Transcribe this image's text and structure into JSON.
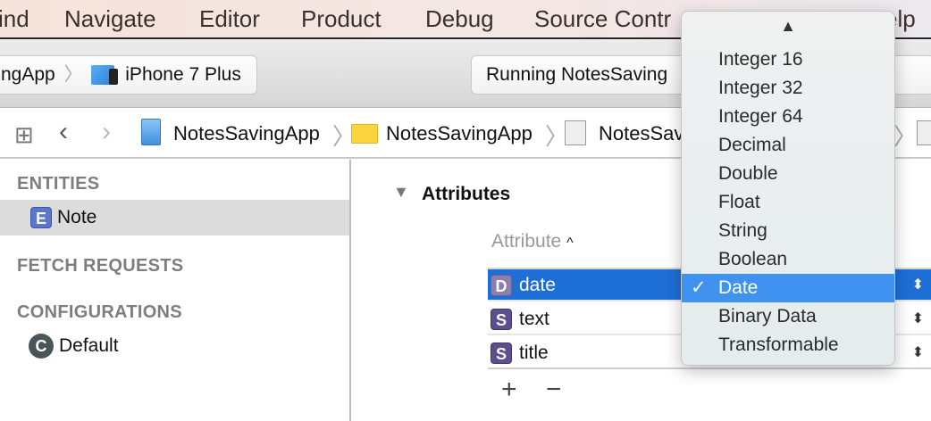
{
  "menubar": {
    "items": [
      "ind",
      "Navigate",
      "Editor",
      "Product",
      "Debug",
      "Source Contr",
      "elp"
    ]
  },
  "toolbar": {
    "scheme": "ngApp",
    "device": "iPhone 7 Plus",
    "status": "Running NotesSaving"
  },
  "breadcrumb": {
    "items": [
      "NotesSavingApp",
      "NotesSavingApp",
      "NotesSav"
    ]
  },
  "sidebar": {
    "entities_header": "ENTITIES",
    "entities": [
      {
        "badge": "E",
        "label": "Note"
      }
    ],
    "fetch_header": "FETCH REQUESTS",
    "config_header": "CONFIGURATIONS",
    "configurations": [
      {
        "badge": "C",
        "label": "Default"
      }
    ]
  },
  "attributes": {
    "section_title": "Attributes",
    "column_header": "Attribute",
    "rows": [
      {
        "badge": "D",
        "name": "date",
        "selected": true
      },
      {
        "badge": "S",
        "name": "text"
      },
      {
        "badge": "S",
        "name": "title"
      }
    ],
    "add": "+",
    "remove": "−"
  },
  "type_menu": {
    "scroll_up": "▲",
    "options": [
      "Integer 16",
      "Integer 32",
      "Integer 64",
      "Decimal",
      "Double",
      "Float",
      "String",
      "Boolean",
      "Date",
      "Binary Data",
      "Transformable"
    ],
    "selected": "Date",
    "check": "✓"
  },
  "colors": {
    "selection": "#1d6fd6",
    "menu_highlight": "#3f92f0"
  }
}
